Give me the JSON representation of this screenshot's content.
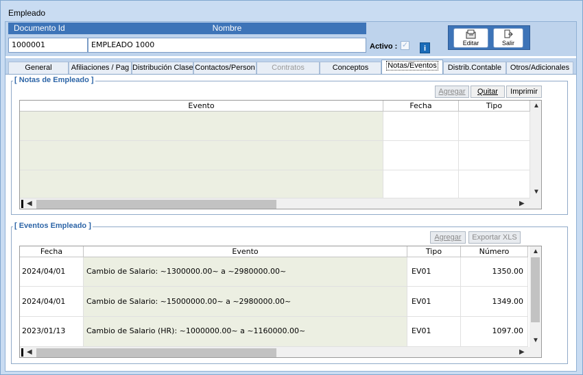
{
  "window": {
    "title": "Empleado"
  },
  "header": {
    "doc_label": "Documento Id",
    "name_label": "Nombre",
    "doc_value": "1000001",
    "name_value": "EMPLEADO 1000",
    "activo_label": "Activo :",
    "info_label": "i",
    "editar_label": "Editar",
    "salir_label": "Salir"
  },
  "tabs": [
    {
      "label": "General",
      "state": "normal"
    },
    {
      "label": "Afiliaciones / Pag",
      "state": "normal"
    },
    {
      "label": "Distribución Clase",
      "state": "normal"
    },
    {
      "label": "Contactos/Person",
      "state": "normal"
    },
    {
      "label": "Contratos",
      "state": "disabled"
    },
    {
      "label": "Conceptos",
      "state": "normal"
    },
    {
      "label": "Notas/Eventos",
      "state": "active"
    },
    {
      "label": "Distrib.Contable",
      "state": "normal"
    },
    {
      "label": "Otros/Adicionales",
      "state": "normal"
    }
  ],
  "notas": {
    "title": "[ Notas de Empleado ]",
    "agregar": "Agregar",
    "quitar": "Quitar",
    "imprimir": "Imprimir",
    "columns": [
      "Evento",
      "Fecha",
      "Tipo"
    ]
  },
  "eventos": {
    "title": "[ Eventos Empleado ]",
    "agregar": "Agregar",
    "exportar": "Exportar XLS",
    "columns": [
      "Fecha",
      "Evento",
      "Tipo",
      "Número"
    ],
    "rows": [
      {
        "fecha": "2024/04/01",
        "evento": "Cambio de Salario: ~1300000.00~ a ~2980000.00~",
        "tipo": "EV01",
        "numero": "1350.00"
      },
      {
        "fecha": "2024/04/01",
        "evento": "Cambio de Salario: ~15000000.00~ a ~2980000.00~",
        "tipo": "EV01",
        "numero": "1349.00"
      },
      {
        "fecha": "2023/01/13",
        "evento": "Cambio de Salario (HR): ~1000000.00~ a ~1160000.00~",
        "tipo": "EV01",
        "numero": "1097.00"
      }
    ]
  },
  "icons": {
    "check": "check-icon",
    "editar": "edit-icon",
    "salir": "exit-icon",
    "scroll_up": "scroll-up-icon",
    "scroll_down": "scroll-down-icon",
    "scroll_left": "scroll-left-icon",
    "scroll_right": "scroll-right-icon"
  },
  "colors": {
    "window_bg": "#c9dcf2",
    "header_bar": "#3d74b8",
    "group_title": "#2d65a7",
    "evento_cell_bg": "#ecefe2"
  }
}
